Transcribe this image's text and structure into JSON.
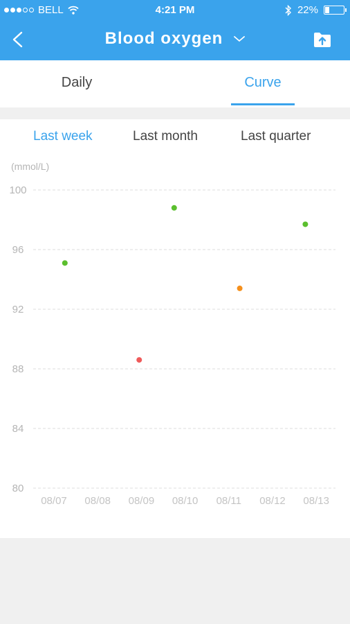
{
  "status_bar": {
    "carrier": "BELL",
    "time": "4:21 PM",
    "battery_text": "22%",
    "battery_level": 0.22
  },
  "nav": {
    "title": "Blood oxygen",
    "back_icon": "chevron-left-icon",
    "dropdown_icon": "chevron-down-icon",
    "upload_icon": "folder-upload-icon"
  },
  "tabs": [
    {
      "label": "Daily",
      "active": false
    },
    {
      "label": "Curve",
      "active": true
    }
  ],
  "periods": [
    {
      "label": "Last week",
      "active": true
    },
    {
      "label": "Last month",
      "active": false
    },
    {
      "label": "Last quarter",
      "active": false
    }
  ],
  "colors": {
    "accent": "#3aa3ec",
    "normal": "#5bbf2e",
    "warning": "#f5901c",
    "alert": "#ef5a5a"
  },
  "chart_data": {
    "type": "scatter",
    "ylabel": "(mmol/L)",
    "ylim": [
      80,
      100
    ],
    "yticks": [
      100,
      96,
      92,
      88,
      84,
      80
    ],
    "categories": [
      "08/07",
      "08/08",
      "08/09",
      "08/10",
      "08/11",
      "08/12",
      "08/13"
    ],
    "grid": true,
    "points": [
      {
        "x": 0.25,
        "y": 95.1,
        "status": "normal"
      },
      {
        "x": 1.95,
        "y": 88.6,
        "status": "alert"
      },
      {
        "x": 2.75,
        "y": 98.8,
        "status": "normal"
      },
      {
        "x": 4.25,
        "y": 93.4,
        "status": "warning"
      },
      {
        "x": 5.75,
        "y": 97.7,
        "status": "normal"
      }
    ]
  }
}
